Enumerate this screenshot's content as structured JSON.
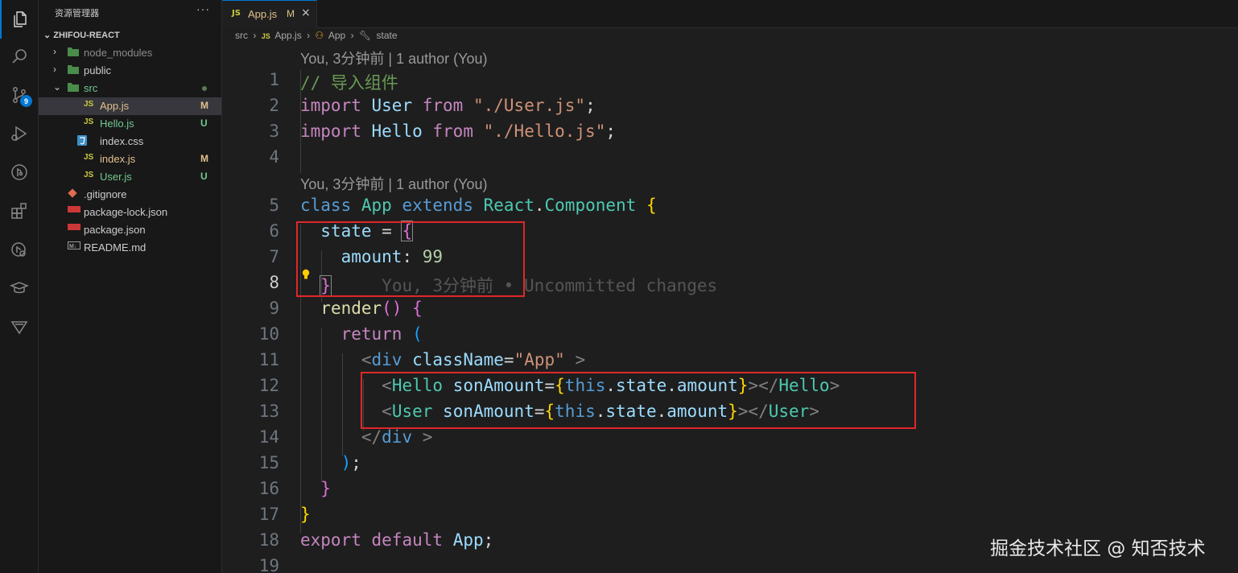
{
  "activity_bar": {
    "items": [
      {
        "icon": "files-icon"
      },
      {
        "icon": "search-icon"
      },
      {
        "icon": "source-control-icon",
        "badge": "9"
      },
      {
        "icon": "run-debug-icon"
      },
      {
        "icon": "git-graph-icon"
      },
      {
        "icon": "extensions-icon"
      },
      {
        "icon": "remote-explorer-icon"
      },
      {
        "icon": "education-icon"
      },
      {
        "icon": "triangle-icon"
      }
    ]
  },
  "explorer": {
    "title": "资源管理器",
    "more": "···",
    "project": "ZHIFOU-REACT",
    "items": [
      {
        "name": "node_modules",
        "type": "folder",
        "expanded": false,
        "status": "",
        "color": "#8b8b8b"
      },
      {
        "name": "public",
        "type": "folder",
        "expanded": false,
        "status": "",
        "color": "#cccccc"
      },
      {
        "name": "src",
        "type": "folder",
        "expanded": true,
        "status": "dot",
        "color": "#73c991"
      },
      {
        "name": "App.js",
        "type": "js",
        "status": "M",
        "color": "#e2c08d"
      },
      {
        "name": "Hello.js",
        "type": "js",
        "status": "U",
        "color": "#73c991"
      },
      {
        "name": "index.css",
        "type": "css",
        "status": "",
        "color": "#cccccc"
      },
      {
        "name": "index.js",
        "type": "js",
        "status": "M",
        "color": "#e2c08d"
      },
      {
        "name": "User.js",
        "type": "js",
        "status": "U",
        "color": "#73c991"
      },
      {
        "name": ".gitignore",
        "type": "git",
        "status": "",
        "color": "#cccccc"
      },
      {
        "name": "package-lock.json",
        "type": "npm",
        "status": "",
        "color": "#cccccc"
      },
      {
        "name": "package.json",
        "type": "npm",
        "status": "",
        "color": "#cccccc"
      },
      {
        "name": "README.md",
        "type": "md",
        "status": "",
        "color": "#cccccc"
      }
    ]
  },
  "tab": {
    "icon": "JS",
    "name": "App.js",
    "status": "M",
    "close": "×"
  },
  "breadcrumb": {
    "folder": "src",
    "file_icon": "JS",
    "file": "App.js",
    "class": "App",
    "member": "state"
  },
  "codelens": {
    "top": "You, 3分钟前 | 1 author (You)",
    "class": "You, 3分钟前 | 1 author (You)"
  },
  "blame_inline": "You, 3分钟前 • Uncommitted changes",
  "current_line": 8,
  "code_lines": [
    "// 导入组件",
    "import User from \"./User.js\";",
    "import Hello from \"./Hello.js\";",
    "",
    "class App extends React.Component {",
    "  state = {",
    "    amount: 99",
    "  }",
    "  render() {",
    "    return (",
    "      <div className=\"App\" >",
    "        <Hello sonAmount={this.state.amount}></Hello>",
    "        <User sonAmount={this.state.amount}></User>",
    "      </div >",
    "    );",
    "  }",
    "}",
    "export default App;",
    ""
  ],
  "watermark": "掘金技术社区 @ 知否技术"
}
